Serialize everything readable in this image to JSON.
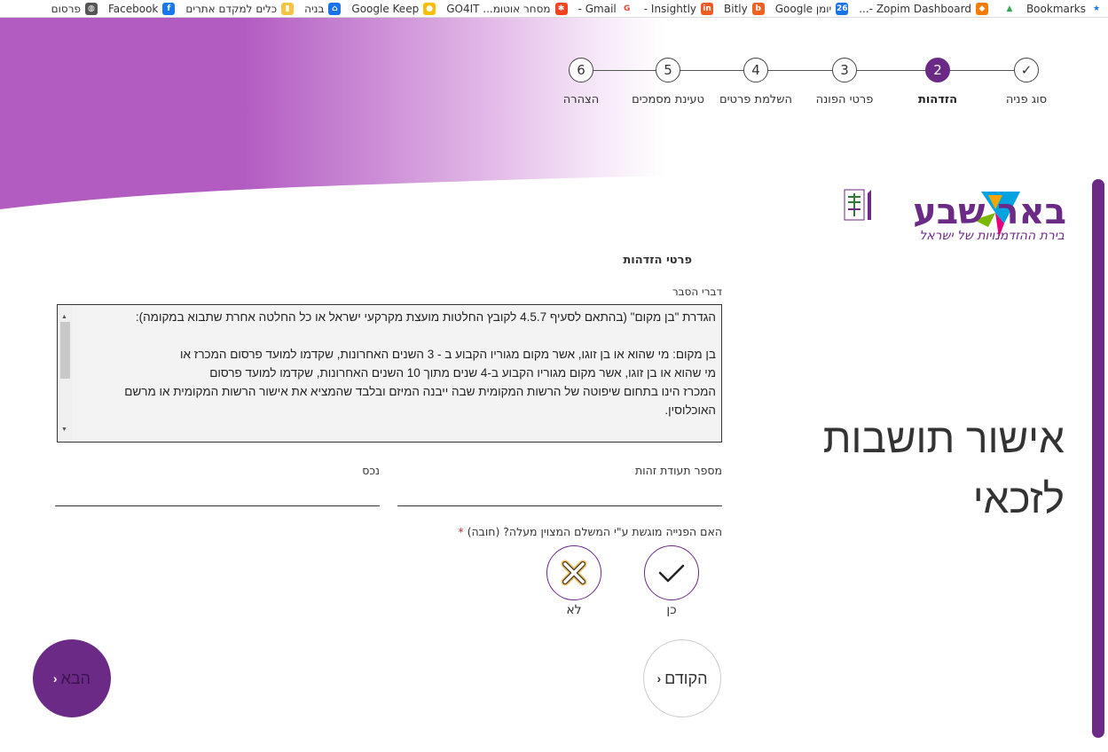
{
  "bookmarks": [
    {
      "label": "Bookmarks",
      "icon": "star-icon",
      "color": "#1a73e8"
    },
    {
      "label": "",
      "icon": "drive-icon",
      "color": "#34a853"
    },
    {
      "label": "Zopim Dashboard -...",
      "icon": "zopim-icon",
      "color": "#f57c00"
    },
    {
      "label": "יומן Google",
      "icon": "calendar-icon",
      "color": "#1a73e8"
    },
    {
      "label": "Bitly",
      "icon": "bitly-icon",
      "color": "#ee6123"
    },
    {
      "label": "Insightly -",
      "icon": "insightly-icon",
      "color": "#f15a22"
    },
    {
      "label": "Gmail -",
      "icon": "google-icon",
      "color": "#ea4335"
    },
    {
      "label": "מסחר אוטומ... GO4IT",
      "icon": "joomla-icon",
      "color": "#f44321"
    },
    {
      "label": "Google Keep",
      "icon": "keep-icon",
      "color": "#fbbc04"
    },
    {
      "label": "בניה",
      "icon": "home-icon",
      "color": "#1a73e8"
    },
    {
      "label": "כלים למקדם אתרים",
      "icon": "folder-icon",
      "color": "#f6c343"
    },
    {
      "label": "Facebook",
      "icon": "facebook-icon",
      "color": "#1877f2"
    },
    {
      "label": "פרסום",
      "icon": "globe-icon",
      "color": "#555555"
    }
  ],
  "stepper": [
    {
      "number": "✓",
      "label": "סוג פניה",
      "state": "done"
    },
    {
      "number": "2",
      "label": "הזדהות",
      "state": "active"
    },
    {
      "number": "3",
      "label": "פרטי הפונה",
      "state": "todo"
    },
    {
      "number": "4",
      "label": "השלמת פרטים",
      "state": "todo"
    },
    {
      "number": "5",
      "label": "טעינת מסמכים",
      "state": "todo"
    },
    {
      "number": "6",
      "label": "הצהרה",
      "state": "todo"
    }
  ],
  "logo": {
    "name": "באר שבע",
    "tagline": "בירת ההזדמנויות של ישראל"
  },
  "page_title_line1": "אישור תושבות",
  "page_title_line2": "לזכאי",
  "form": {
    "section_title": "פרטי הזדהות",
    "explanation_label": "דברי הסבר",
    "explanation_lines": [
      "הגדרת \"בן מקום\" (בהתאם לסעיף 4.5.7 לקובץ החלטות מועצת מקרקעי ישראל או כל החלטה אחרת שתבוא במקומה):",
      "",
      "בן מקום: מי שהוא או בן זוגו, אשר מקום מגוריו הקבוע ב - 3 השנים האחרונות, שקדמו למועד פרסום המכרז או",
      "מי שהוא או בן זוגו, אשר מקום מגוריו הקבוע ב-4 שנים מתוך 10 השנים האחרונות, שקדמו למועד פרסום",
      "המכרז הינו בתחום שיפוטה של הרשות המקומית שבה ייבנה המיזם ובלבד שהמציא את אישור הרשות המקומית או מרשם",
      "האוכלוסין."
    ],
    "id_label": "מספר תעודת זהות",
    "asset_label": "נכס",
    "question": "האם הפנייה מוגשת ע\"י המשלם המצוין מעלה? (חובה)",
    "required_mark": "*",
    "yes_label": "כן",
    "no_label": "לא"
  },
  "nav": {
    "prev_label": "הקודם",
    "next_label": "הבא"
  },
  "colors": {
    "brand_purple": "#6b2a86",
    "header_gradient": "#b056c0"
  }
}
